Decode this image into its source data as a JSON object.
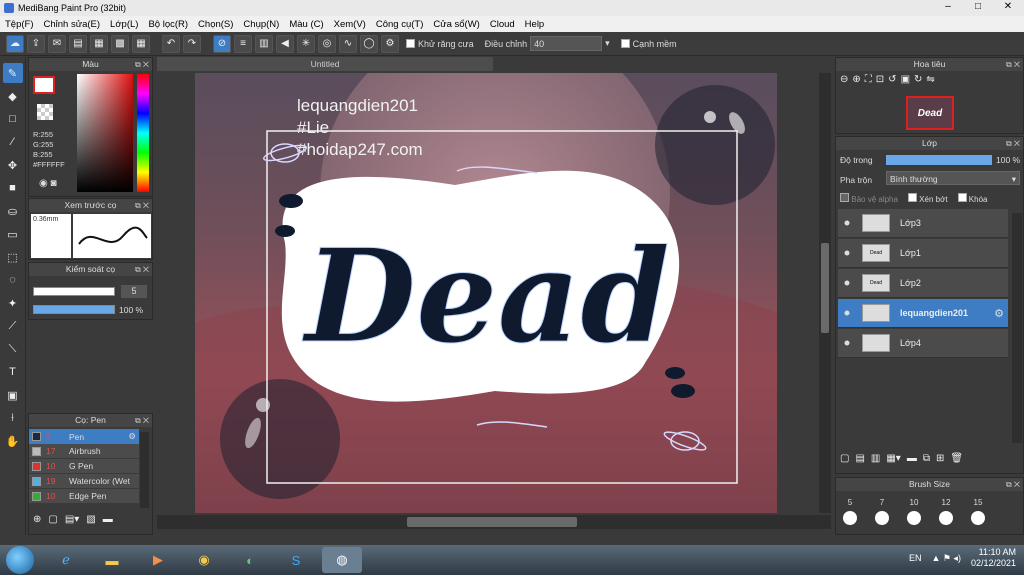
{
  "window": {
    "title": "MediBang Paint Pro (32bit)",
    "minimize": "–",
    "maximize": "□",
    "close": "✕"
  },
  "menu": [
    "Tệp(F)",
    "Chỉnh sửa(E)",
    "Lớp(L)",
    "Bộ lọc(R)",
    "Chọn(S)",
    "Chụp(N)",
    "Màu (C)",
    "Xem(V)",
    "Công cụ(T)",
    "Cửa sổ(W)",
    "Cloud",
    "Help"
  ],
  "toolbar": {
    "antialias_label": "Khử răng cưa",
    "adjust_label": "Điều chỉnh",
    "adjust_value": "40",
    "edge_label": "Cạnh mềm"
  },
  "color_panel": {
    "title": "Màu",
    "r": "R:255",
    "g": "G:255",
    "b": "B:255",
    "hex": "#FFFFFF"
  },
  "brush_preview": {
    "title": "Xem trước cọ",
    "size": "0.36mm"
  },
  "brush_control": {
    "title": "Kiểm soát cọ",
    "size_value": "5",
    "opacity_value": "100 %"
  },
  "pen_panel": {
    "title": "Cọ: Pen",
    "items": [
      {
        "size": "5",
        "name": "Pen",
        "color": "#1a2a40"
      },
      {
        "size": "17",
        "name": "Airbrush",
        "color": "#bbbbbb"
      },
      {
        "size": "10",
        "name": "G Pen",
        "color": "#e03030"
      },
      {
        "size": "19",
        "name": "Watercolor (Wet",
        "color": "#55b0e0"
      },
      {
        "size": "10",
        "name": "Edge Pen",
        "color": "#30b030"
      }
    ]
  },
  "document": {
    "tab": "Untitled",
    "watermark_lines": [
      "lequangdien201",
      "#Lie",
      "#hoidap247.com"
    ],
    "artwork_text": "Dead"
  },
  "navigator": {
    "title": "Hoa tiêu"
  },
  "layers": {
    "title": "Lớp",
    "opacity_label": "Độ trong",
    "opacity_value": "100 %",
    "blend_label": "Pha trộn",
    "blend_value": "Bình thường",
    "protect_alpha": "Bảo vệ alpha",
    "clip": "Xén bớt",
    "lock": "Khóa",
    "items": [
      {
        "name": "Lớp3",
        "selected": false,
        "thumb": ""
      },
      {
        "name": "Lớp1",
        "selected": false,
        "thumb": "Dead"
      },
      {
        "name": "Lớp2",
        "selected": false,
        "thumb": "Dead"
      },
      {
        "name": "lequangdien201",
        "selected": true,
        "thumb": ""
      },
      {
        "name": "Lớp4",
        "selected": false,
        "thumb": ""
      }
    ]
  },
  "brush_size": {
    "title": "Brush Size",
    "sizes": [
      "5",
      "7",
      "10",
      "12",
      "15"
    ]
  },
  "taskbar": {
    "lang": "EN",
    "time": "11:10 AM",
    "date": "02/12/2021"
  }
}
